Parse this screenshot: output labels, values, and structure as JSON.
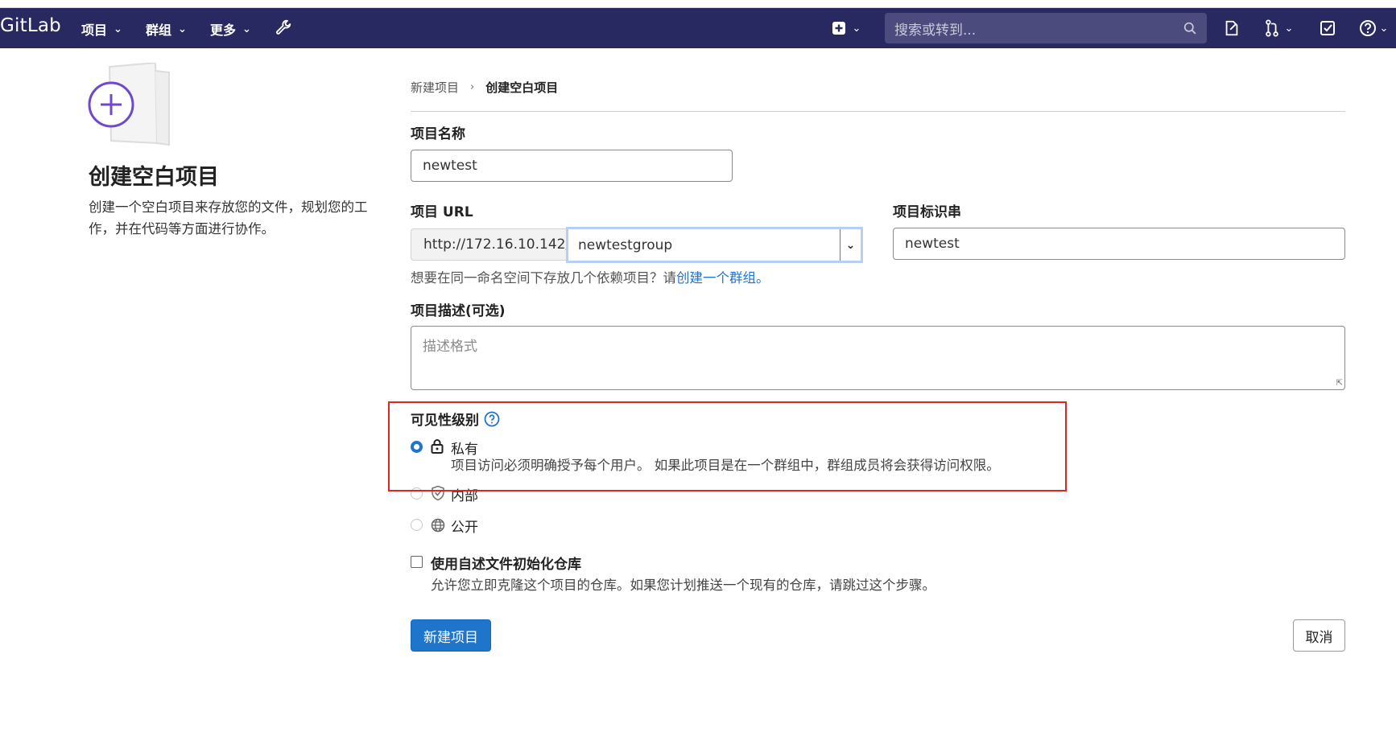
{
  "navbar": {
    "logo": "GitLab",
    "menus": [
      {
        "label": "项目"
      },
      {
        "label": "群组"
      },
      {
        "label": "更多"
      }
    ],
    "search_placeholder": "搜索或转到..."
  },
  "sidebar": {
    "title": "创建空白项目",
    "description": "创建一个空白项目来存放您的文件，规划您的工作，并在代码等方面进行协作。"
  },
  "breadcrumb": {
    "parent": "新建项目",
    "current": "创建空白项目"
  },
  "form": {
    "project_name_label": "项目名称",
    "project_name_value": "newtest",
    "project_url_label": "项目 URL",
    "url_prefix": "http://172.16.10.142/",
    "namespace_value": "newtestgroup",
    "slug_label": "项目标识串",
    "slug_value": "newtest",
    "hint_text": "想要在同一命名空间下存放几个依赖项目？请",
    "hint_link": "创建一个群组。",
    "description_label": "项目描述(可选)",
    "description_placeholder": "描述格式",
    "visibility_label": "可见性级别",
    "visibility_options": [
      {
        "label": "私有",
        "selected": true,
        "description": "项目访问必须明确授予每个用户。 如果此项目是在一个群组中，群组成员将会获得访问权限。",
        "icon": "lock-icon"
      },
      {
        "label": "内部",
        "selected": false,
        "icon": "shield-icon"
      },
      {
        "label": "公开",
        "selected": false,
        "icon": "globe-icon"
      }
    ],
    "readme_label": "使用自述文件初始化仓库",
    "readme_checked": false,
    "readme_description": "允许您立即克隆这个项目的仓库。如果您计划推送一个现有的仓库，请跳过这个步骤。",
    "submit_label": "新建项目",
    "cancel_label": "取消"
  },
  "colors": {
    "navbar_bg": "#292961",
    "primary": "#1f75cb",
    "highlight_box": "#e02424",
    "illustration_accent": "#6e49cb"
  }
}
